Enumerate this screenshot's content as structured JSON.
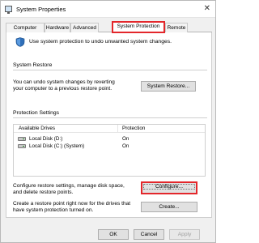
{
  "window": {
    "title": "System Properties",
    "close_glyph": "✕"
  },
  "tabs": [
    {
      "label": "Computer Name",
      "active": false
    },
    {
      "label": "Hardware",
      "active": false
    },
    {
      "label": "Advanced",
      "active": false
    },
    {
      "label": "System Protection",
      "active": true
    },
    {
      "label": "Remote",
      "active": false
    }
  ],
  "intro_text": "Use system protection to undo unwanted system changes.",
  "system_restore": {
    "title": "System Restore",
    "description_line1": "You can undo system changes by reverting",
    "description_line2": "your computer to a previous restore point.",
    "button_label": "System Restore..."
  },
  "protection_settings": {
    "title": "Protection Settings",
    "columns": [
      "Available Drives",
      "Protection"
    ],
    "drives": [
      {
        "name": "Local Disk (D:)",
        "protection": "On"
      },
      {
        "name": "Local Disk (C:) (System)",
        "protection": "On"
      }
    ],
    "configure_line1": "Configure restore settings, manage disk space,",
    "configure_line2": "and delete restore points.",
    "configure_button": "Configure...",
    "create_line1": "Create a restore point right now for the drives that",
    "create_line2": "have system protection turned on.",
    "create_button": "Create..."
  },
  "footer": {
    "ok": "OK",
    "cancel": "Cancel",
    "apply": "Apply"
  },
  "colors": {
    "highlight": "#e3272b",
    "shield": "#2f6fb9"
  },
  "icons": [
    "app-icon",
    "close-icon",
    "shield-icon",
    "drive-icon"
  ]
}
